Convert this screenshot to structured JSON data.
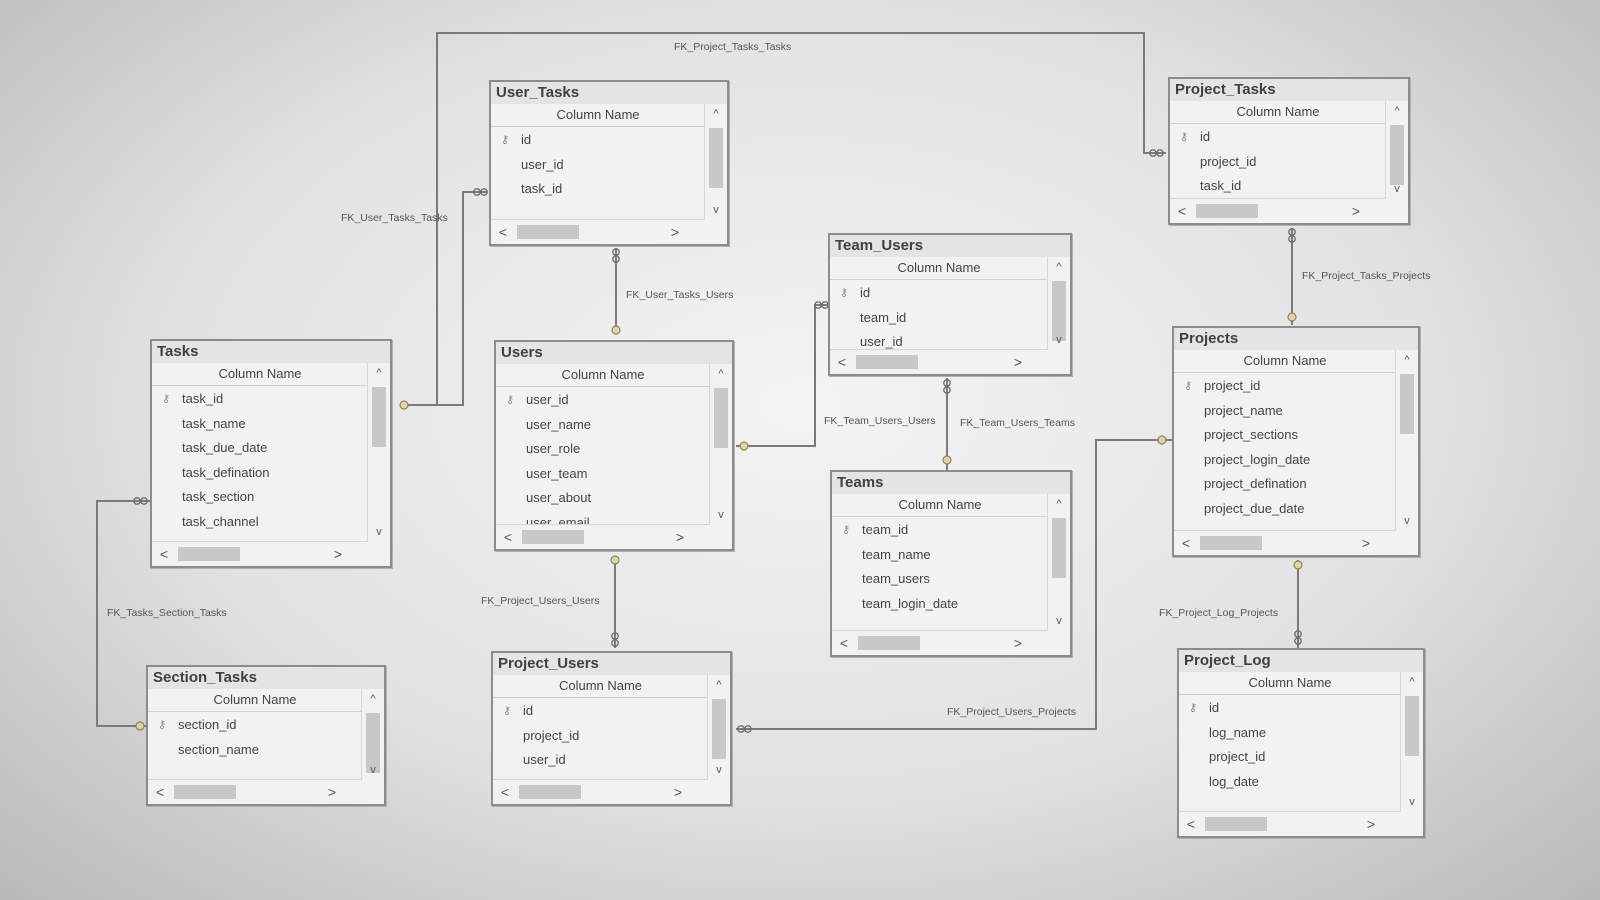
{
  "column_header": "Column Name",
  "key_glyph": "⚷",
  "glyphs": {
    "up": "^",
    "down": "v",
    "left": "<",
    "right": ">"
  },
  "tables": [
    {
      "id": "user_tasks",
      "title": "User_Tasks",
      "columns": [
        "id",
        "user_id",
        "task_id"
      ],
      "pk": [
        0
      ]
    },
    {
      "id": "project_tasks",
      "title": "Project_Tasks",
      "columns": [
        "id",
        "project_id",
        "task_id"
      ],
      "pk": [
        0
      ]
    },
    {
      "id": "team_users",
      "title": "Team_Users",
      "columns": [
        "id",
        "team_id",
        "user_id"
      ],
      "pk": [
        0
      ]
    },
    {
      "id": "tasks",
      "title": "Tasks",
      "columns": [
        "task_id",
        "task_name",
        "task_due_date",
        "task_defination",
        "task_section",
        "task_channel"
      ],
      "pk": [
        0
      ]
    },
    {
      "id": "users",
      "title": "Users",
      "columns": [
        "user_id",
        "user_name",
        "user_role",
        "user_team",
        "user_about",
        "user_email"
      ],
      "pk": [
        0
      ]
    },
    {
      "id": "projects",
      "title": "Projects",
      "columns": [
        "project_id",
        "project_name",
        "project_sections",
        "project_login_date",
        "project_defination",
        "project_due_date"
      ],
      "pk": [
        0
      ]
    },
    {
      "id": "teams",
      "title": "Teams",
      "columns": [
        "team_id",
        "team_name",
        "team_users",
        "team_login_date"
      ],
      "pk": [
        0
      ]
    },
    {
      "id": "section_tasks",
      "title": "Section_Tasks",
      "columns": [
        "section_id",
        "section_name"
      ],
      "pk": [
        0
      ]
    },
    {
      "id": "project_users",
      "title": "Project_Users",
      "columns": [
        "id",
        "project_id",
        "user_id"
      ],
      "pk": [
        0
      ]
    },
    {
      "id": "project_log",
      "title": "Project_Log",
      "columns": [
        "id",
        "log_name",
        "project_id",
        "log_date"
      ],
      "pk": [
        0
      ]
    }
  ],
  "relationships": [
    {
      "name": "FK_Project_Tasks_Tasks",
      "from": "project_tasks",
      "to": "tasks"
    },
    {
      "name": "FK_User_Tasks_Tasks",
      "from": "user_tasks",
      "to": "tasks"
    },
    {
      "name": "FK_User_Tasks_Users",
      "from": "user_tasks",
      "to": "users"
    },
    {
      "name": "FK_Project_Tasks_Projects",
      "from": "project_tasks",
      "to": "projects"
    },
    {
      "name": "FK_Team_Users_Users",
      "from": "team_users",
      "to": "users"
    },
    {
      "name": "FK_Team_Users_Teams",
      "from": "team_users",
      "to": "teams"
    },
    {
      "name": "FK_Tasks_Section_Tasks",
      "from": "tasks",
      "to": "section_tasks"
    },
    {
      "name": "FK_Project_Users_Users",
      "from": "project_users",
      "to": "users"
    },
    {
      "name": "FK_Project_Log_Projects",
      "from": "project_log",
      "to": "projects"
    },
    {
      "name": "FK_Project_Users_Projects",
      "from": "project_users",
      "to": "projects"
    }
  ]
}
